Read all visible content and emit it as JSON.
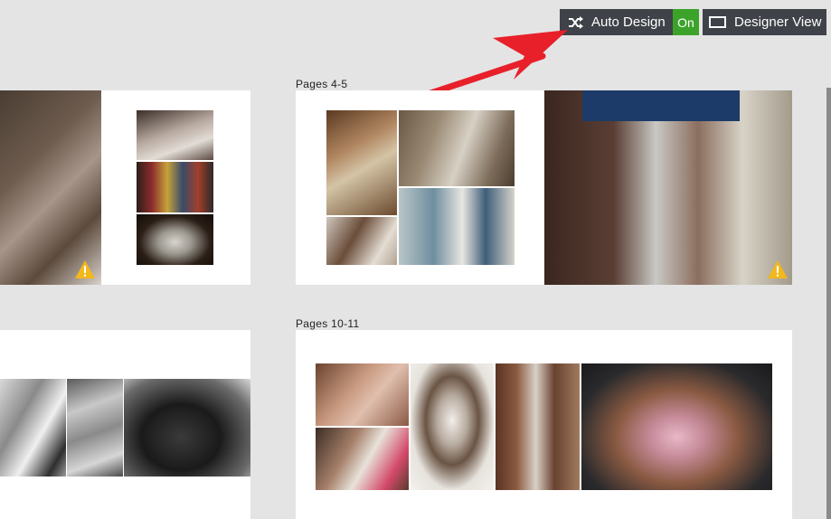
{
  "toolbar": {
    "auto_design_label": "Auto Design",
    "auto_design_state": "On",
    "designer_view_label": "Designer View",
    "icons": {
      "auto_design": "shuffle-icon",
      "designer_view": "monitor-icon"
    }
  },
  "spreads": [
    {
      "title": "Pages 4-5",
      "warning_icon": "warning-icon"
    },
    {
      "title": "Pages 10-11"
    }
  ],
  "colors": {
    "background": "#e4e4e4",
    "toolbar": "#3f4248",
    "toggle_on": "#3ca32a",
    "arrow": "#e8202a",
    "warning": "#f2b81c"
  }
}
